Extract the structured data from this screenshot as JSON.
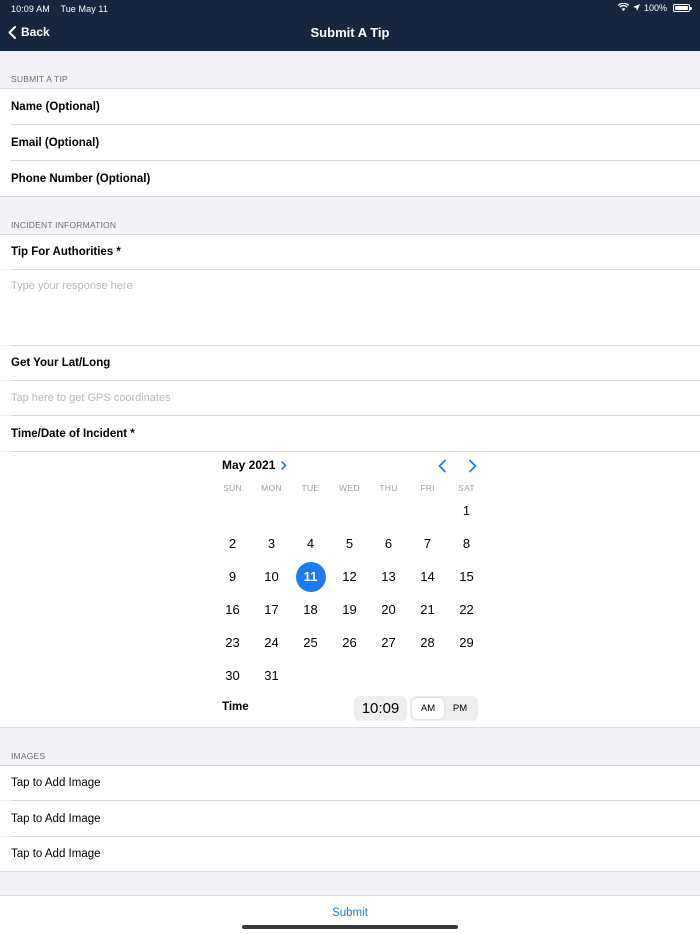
{
  "status_bar": {
    "time": "10:09 AM",
    "date": "Tue May 11",
    "battery": "100%"
  },
  "nav": {
    "back_label": "Back",
    "title": "Submit A Tip"
  },
  "sections": {
    "submit_tip": "SUBMIT A TIP",
    "incident": "INCIDENT INFORMATION",
    "images": "IMAGES"
  },
  "fields": {
    "name_label": "Name (Optional)",
    "email_label": "Email (Optional)",
    "phone_label": "Phone Number (Optional)",
    "tip_label": "Tip For Authorities *",
    "tip_placeholder": "Type your response here",
    "latlong_label": "Get Your Lat/Long",
    "gps_placeholder": "Tap here to get GPS coordinates",
    "datetime_label": "Time/Date of Incident *"
  },
  "calendar": {
    "month_label": "May 2021",
    "weekdays": [
      "SUN",
      "MON",
      "TUE",
      "WED",
      "THU",
      "FRI",
      "SAT"
    ],
    "days": [
      "1",
      "2",
      "3",
      "4",
      "5",
      "6",
      "7",
      "8",
      "9",
      "10",
      "11",
      "12",
      "13",
      "14",
      "15",
      "16",
      "17",
      "18",
      "19",
      "20",
      "21",
      "22",
      "23",
      "24",
      "25",
      "26",
      "27",
      "28",
      "29",
      "30",
      "31"
    ],
    "selected_day": "11",
    "time_label": "Time",
    "time_value": "10:09",
    "am_label": "AM",
    "pm_label": "PM",
    "selected_period": "AM"
  },
  "images": {
    "items": [
      "Tap to Add Image",
      "Tap to Add Image",
      "Tap to Add Image"
    ]
  },
  "submit_label": "Submit",
  "colors": {
    "nav_background": "#15273f",
    "accent": "#1a7cf5",
    "grouped_background": "#f2f2f7"
  }
}
